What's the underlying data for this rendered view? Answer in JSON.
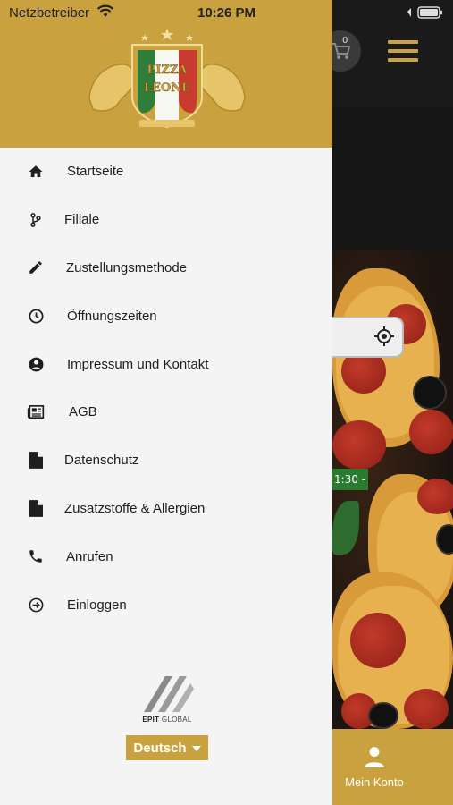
{
  "status_bar": {
    "carrier": "Netzbetreiber",
    "time": "10:26 PM"
  },
  "header": {
    "cart_count": "0",
    "logo_text": "PIZZA LEONE"
  },
  "menu": {
    "items": [
      {
        "label": "Startseite",
        "icon": "home-icon"
      },
      {
        "label": "Filiale",
        "icon": "branch-icon"
      },
      {
        "label": "Zustellungsmethode",
        "icon": "pencil-icon"
      },
      {
        "label": "Öffnungszeiten",
        "icon": "clock-icon"
      },
      {
        "label": "Impressum und Kontakt",
        "icon": "account-circle-icon"
      },
      {
        "label": "AGB",
        "icon": "newspaper-icon"
      },
      {
        "label": "Datenschutz",
        "icon": "document-icon"
      },
      {
        "label": "Zusatzstoffe & Allergien",
        "icon": "document-icon"
      },
      {
        "label": "Anrufen",
        "icon": "phone-icon"
      },
      {
        "label": "Einloggen",
        "icon": "login-icon"
      }
    ]
  },
  "footer": {
    "brand_bold": "EPIT",
    "brand_light": "GLOBAL",
    "language": "Deutsch"
  },
  "background": {
    "time_tag": "1:30 -",
    "account_tab_label": "Mein Konto"
  },
  "colors": {
    "gold": "#c9a13f",
    "drawer_bg": "#f4f4f4",
    "dark_bg": "#161616",
    "green_tag": "#2a7a2f"
  }
}
